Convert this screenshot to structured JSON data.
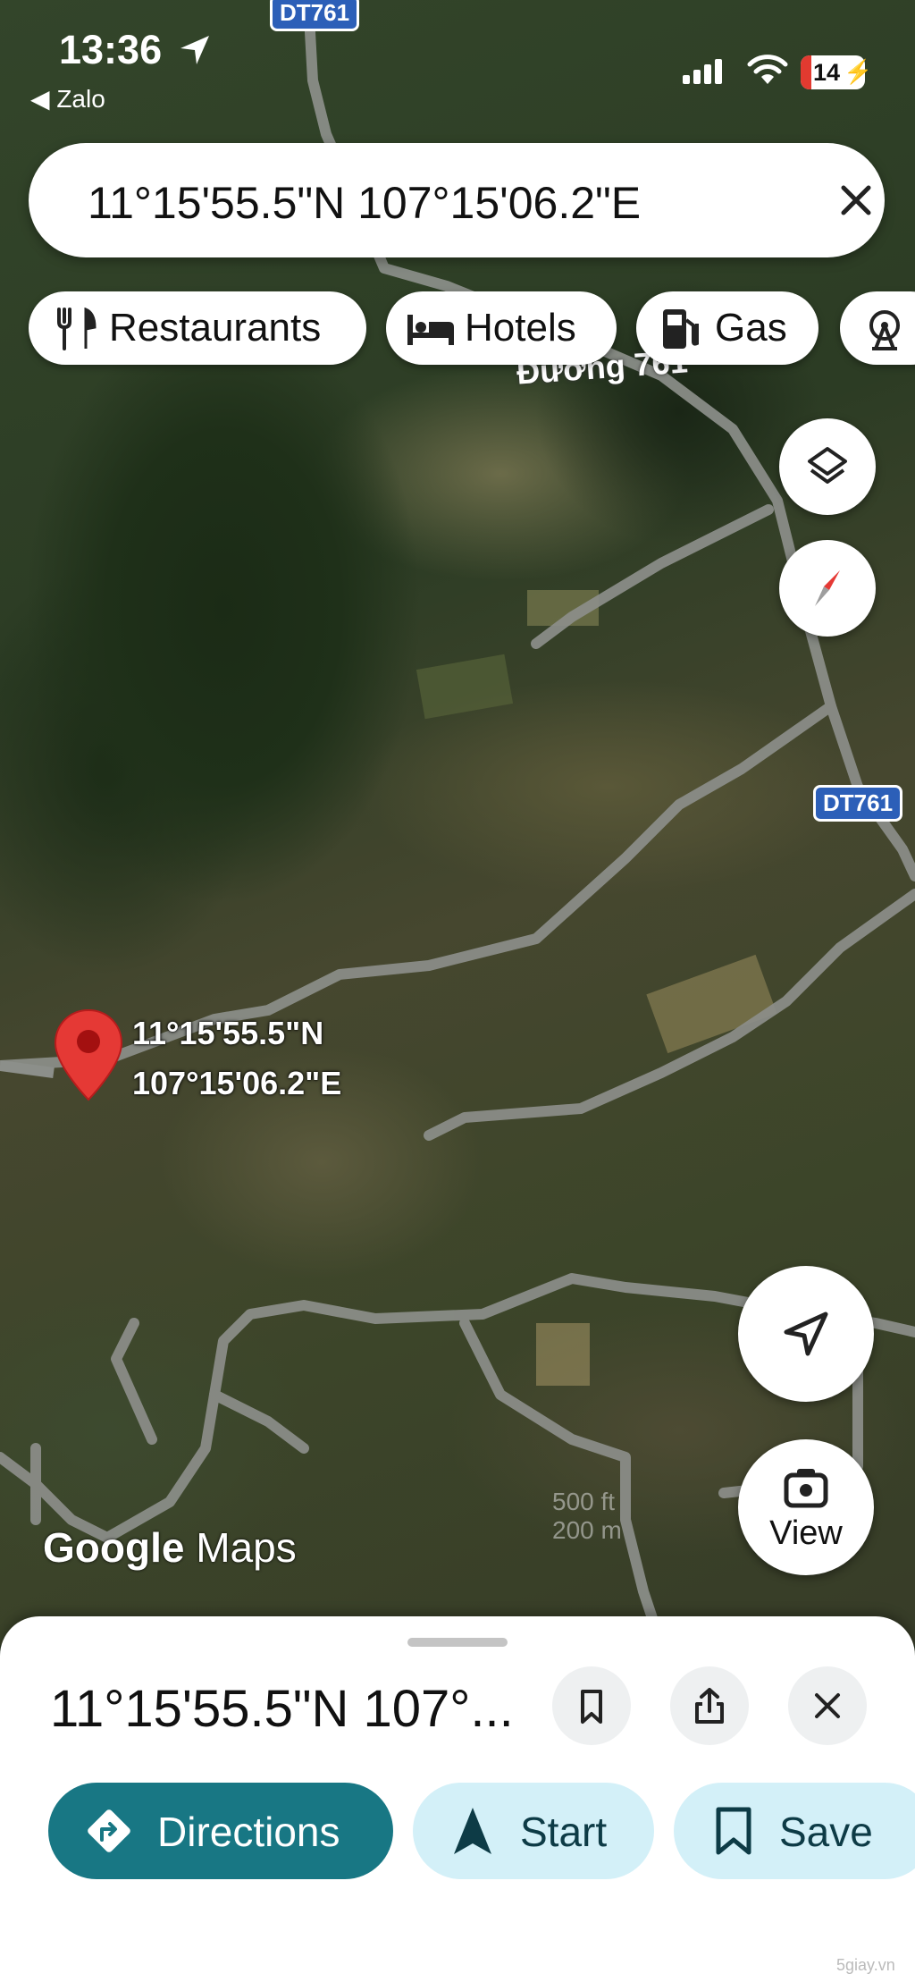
{
  "status_bar": {
    "time": "13:36",
    "back_app": "◀ Zalo",
    "battery": "14"
  },
  "search": {
    "query": "11°15'55.5\"N 107°15'06.2\"E"
  },
  "chips": [
    {
      "label": "Restaurants",
      "icon": "fork-knife-icon"
    },
    {
      "label": "Hotels",
      "icon": "bed-icon"
    },
    {
      "label": "Gas",
      "icon": "gas-pump-icon"
    },
    {
      "label": "",
      "icon": "ferris-wheel-icon"
    }
  ],
  "map": {
    "road_sign_top": "DT761",
    "road_sign_right": "DT761",
    "road_label": "Đường 761",
    "pin_label_line1": "11°15'55.5\"N",
    "pin_label_line2": "107°15'06.2\"E",
    "logo_google": "Google",
    "logo_maps": "Maps",
    "scale_imperial": "500 ft",
    "scale_metric": "200 m",
    "view_button": "View"
  },
  "sheet": {
    "title": "11°15'55.5\"N 107°...",
    "directions_label": "Directions",
    "start_label": "Start",
    "save_label": "Save"
  },
  "watermark": "5giay.vn",
  "colors": {
    "directions_bg": "#187784",
    "secondary_bg": "#d3f0f8",
    "pin_red": "#e53935",
    "road_sign_blue": "#2c5fb8"
  }
}
